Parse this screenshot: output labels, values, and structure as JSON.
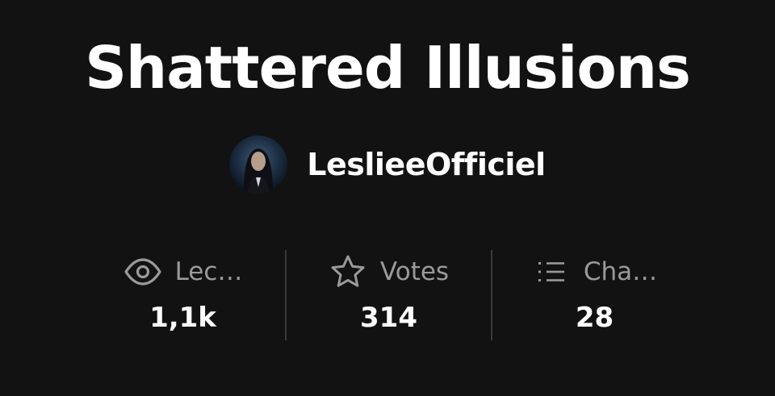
{
  "story": {
    "title": "Shattered Illusions"
  },
  "author": {
    "name": "LeslieeOfficiel"
  },
  "stats": [
    {
      "icon": "eye-icon",
      "label": "Lec…",
      "value": "1,1k"
    },
    {
      "icon": "star-icon",
      "label": "Votes",
      "value": "314"
    },
    {
      "icon": "list-icon",
      "label": "Cha…",
      "value": "28"
    }
  ],
  "colors": {
    "background": "#121212",
    "text": "#ffffff",
    "muted": "#9a9a9a",
    "divider": "#3a3a3a"
  }
}
